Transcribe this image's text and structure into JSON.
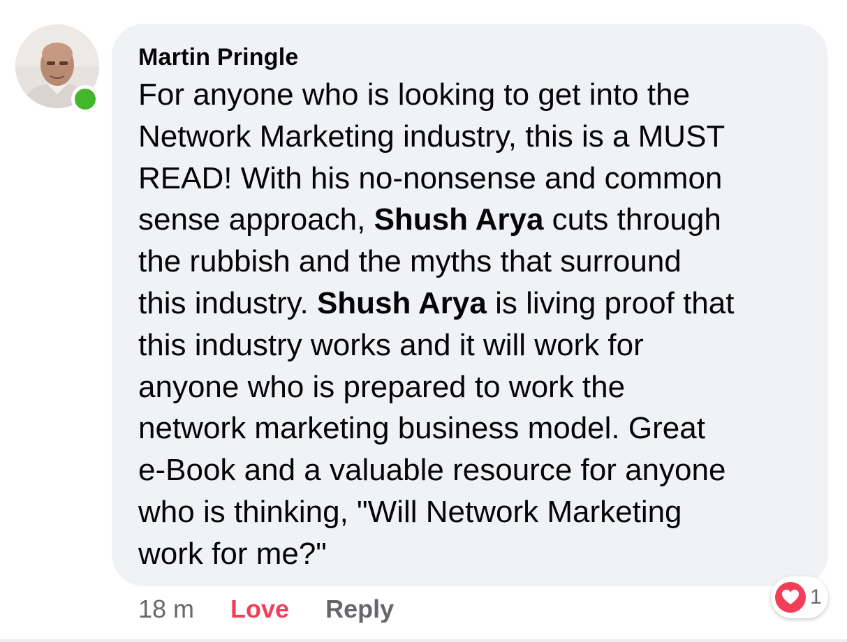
{
  "comment": {
    "author": "Martin Pringle",
    "lines": [
      [
        {
          "text": "For anyone who is looking to get into the"
        }
      ],
      [
        {
          "text": "Network Marketing industry, this is a MUST"
        }
      ],
      [
        {
          "text": "READ! With his no-nonsense and common"
        }
      ],
      [
        {
          "text": "sense approach, "
        },
        {
          "text": "Shush Arya",
          "bold": true
        },
        {
          "text": " cuts through"
        }
      ],
      [
        {
          "text": "the rubbish and the myths that surround"
        }
      ],
      [
        {
          "text": "this industry. "
        },
        {
          "text": "Shush Arya",
          "bold": true
        },
        {
          "text": " is living proof that"
        }
      ],
      [
        {
          "text": "this industry works and it will work for"
        }
      ],
      [
        {
          "text": "anyone who is prepared to work the"
        }
      ],
      [
        {
          "text": "network marketing business model. Great"
        }
      ],
      [
        {
          "text": "e-Book and a valuable resource for anyone"
        }
      ],
      [
        {
          "text": "who is thinking, \"Will Network Marketing"
        }
      ],
      [
        {
          "text": "work for me?\""
        }
      ]
    ],
    "timestamp": "18 m",
    "love_label": "Love",
    "reply_label": "Reply",
    "reaction_count": "1",
    "reaction_icon": "heart-icon"
  },
  "colors": {
    "bubble_bg": "#f0f2f5",
    "love_red": "#f33e58",
    "online_green": "#42b72a",
    "meta_gray": "#65676b"
  }
}
